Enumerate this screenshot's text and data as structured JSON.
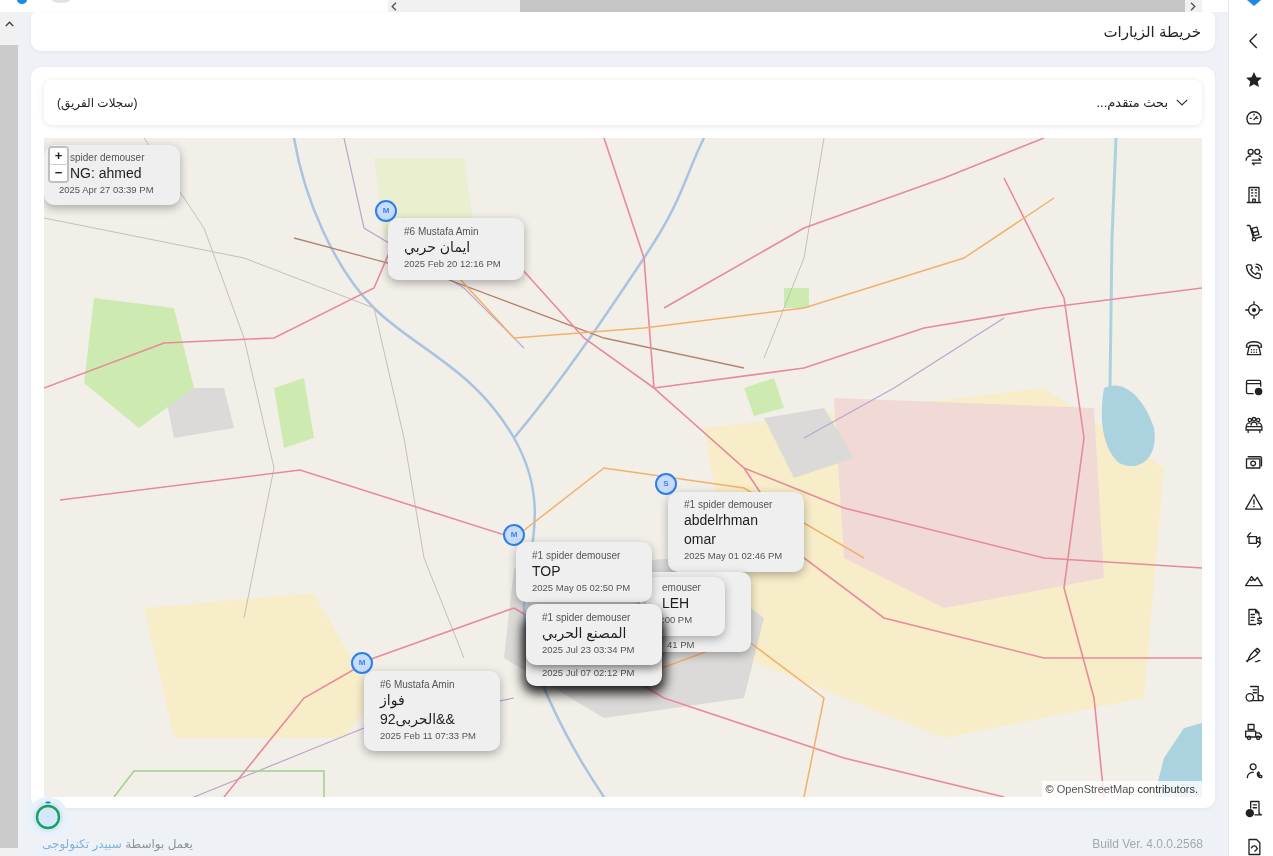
{
  "page": {
    "title": "خريطة الزيارات"
  },
  "filter_bar": {
    "records_label": "(سجلات الفريق)",
    "advanced_search": "بحث متقدم..."
  },
  "map": {
    "zoom_in": "+",
    "zoom_out": "−",
    "markers": [
      {
        "label": "M"
      },
      {
        "label": "S"
      },
      {
        "label": "M"
      },
      {
        "label": "M"
      }
    ],
    "popups": [
      {
        "user": "spider demouser",
        "name": "NG: ahmed",
        "date": "2025 Apr 27 03:39 PM"
      },
      {
        "user": "#6 Mustafa Amin",
        "name": "ايمان حربي",
        "date": "2025 Feb 20 12:16 PM"
      },
      {
        "user": "#1 spider demouser",
        "name": "abdelrhman omar",
        "date": "2025 May 01 02:46 PM"
      },
      {
        "user": "#1 spider demouser",
        "name": "TOP",
        "date": "2025 May 05 02:50 PM"
      },
      {
        "user": "emouser",
        "name": "LEH",
        "date": ":00 PM"
      },
      {
        "date": "41 PM"
      },
      {
        "user": "#1 spider demouser",
        "name": "المصنع الحربي",
        "date": "2025 Jul 23 03:34 PM"
      },
      {
        "date": "2025 Jul 07 02:12 PM"
      },
      {
        "user": "#6 Mustafa Amin",
        "name": "فواز الحربى92&&",
        "date": "2025 Feb 11 07:33 PM"
      }
    ],
    "attribution": {
      "symbol": "©",
      "link": "OpenStreetMap",
      "text": "contributors."
    }
  },
  "footer": {
    "powered_by": "يعمل بواسطة",
    "company": "سبيدر تكنولوجى",
    "build": "Build Ver. 4.0.0.2568"
  }
}
